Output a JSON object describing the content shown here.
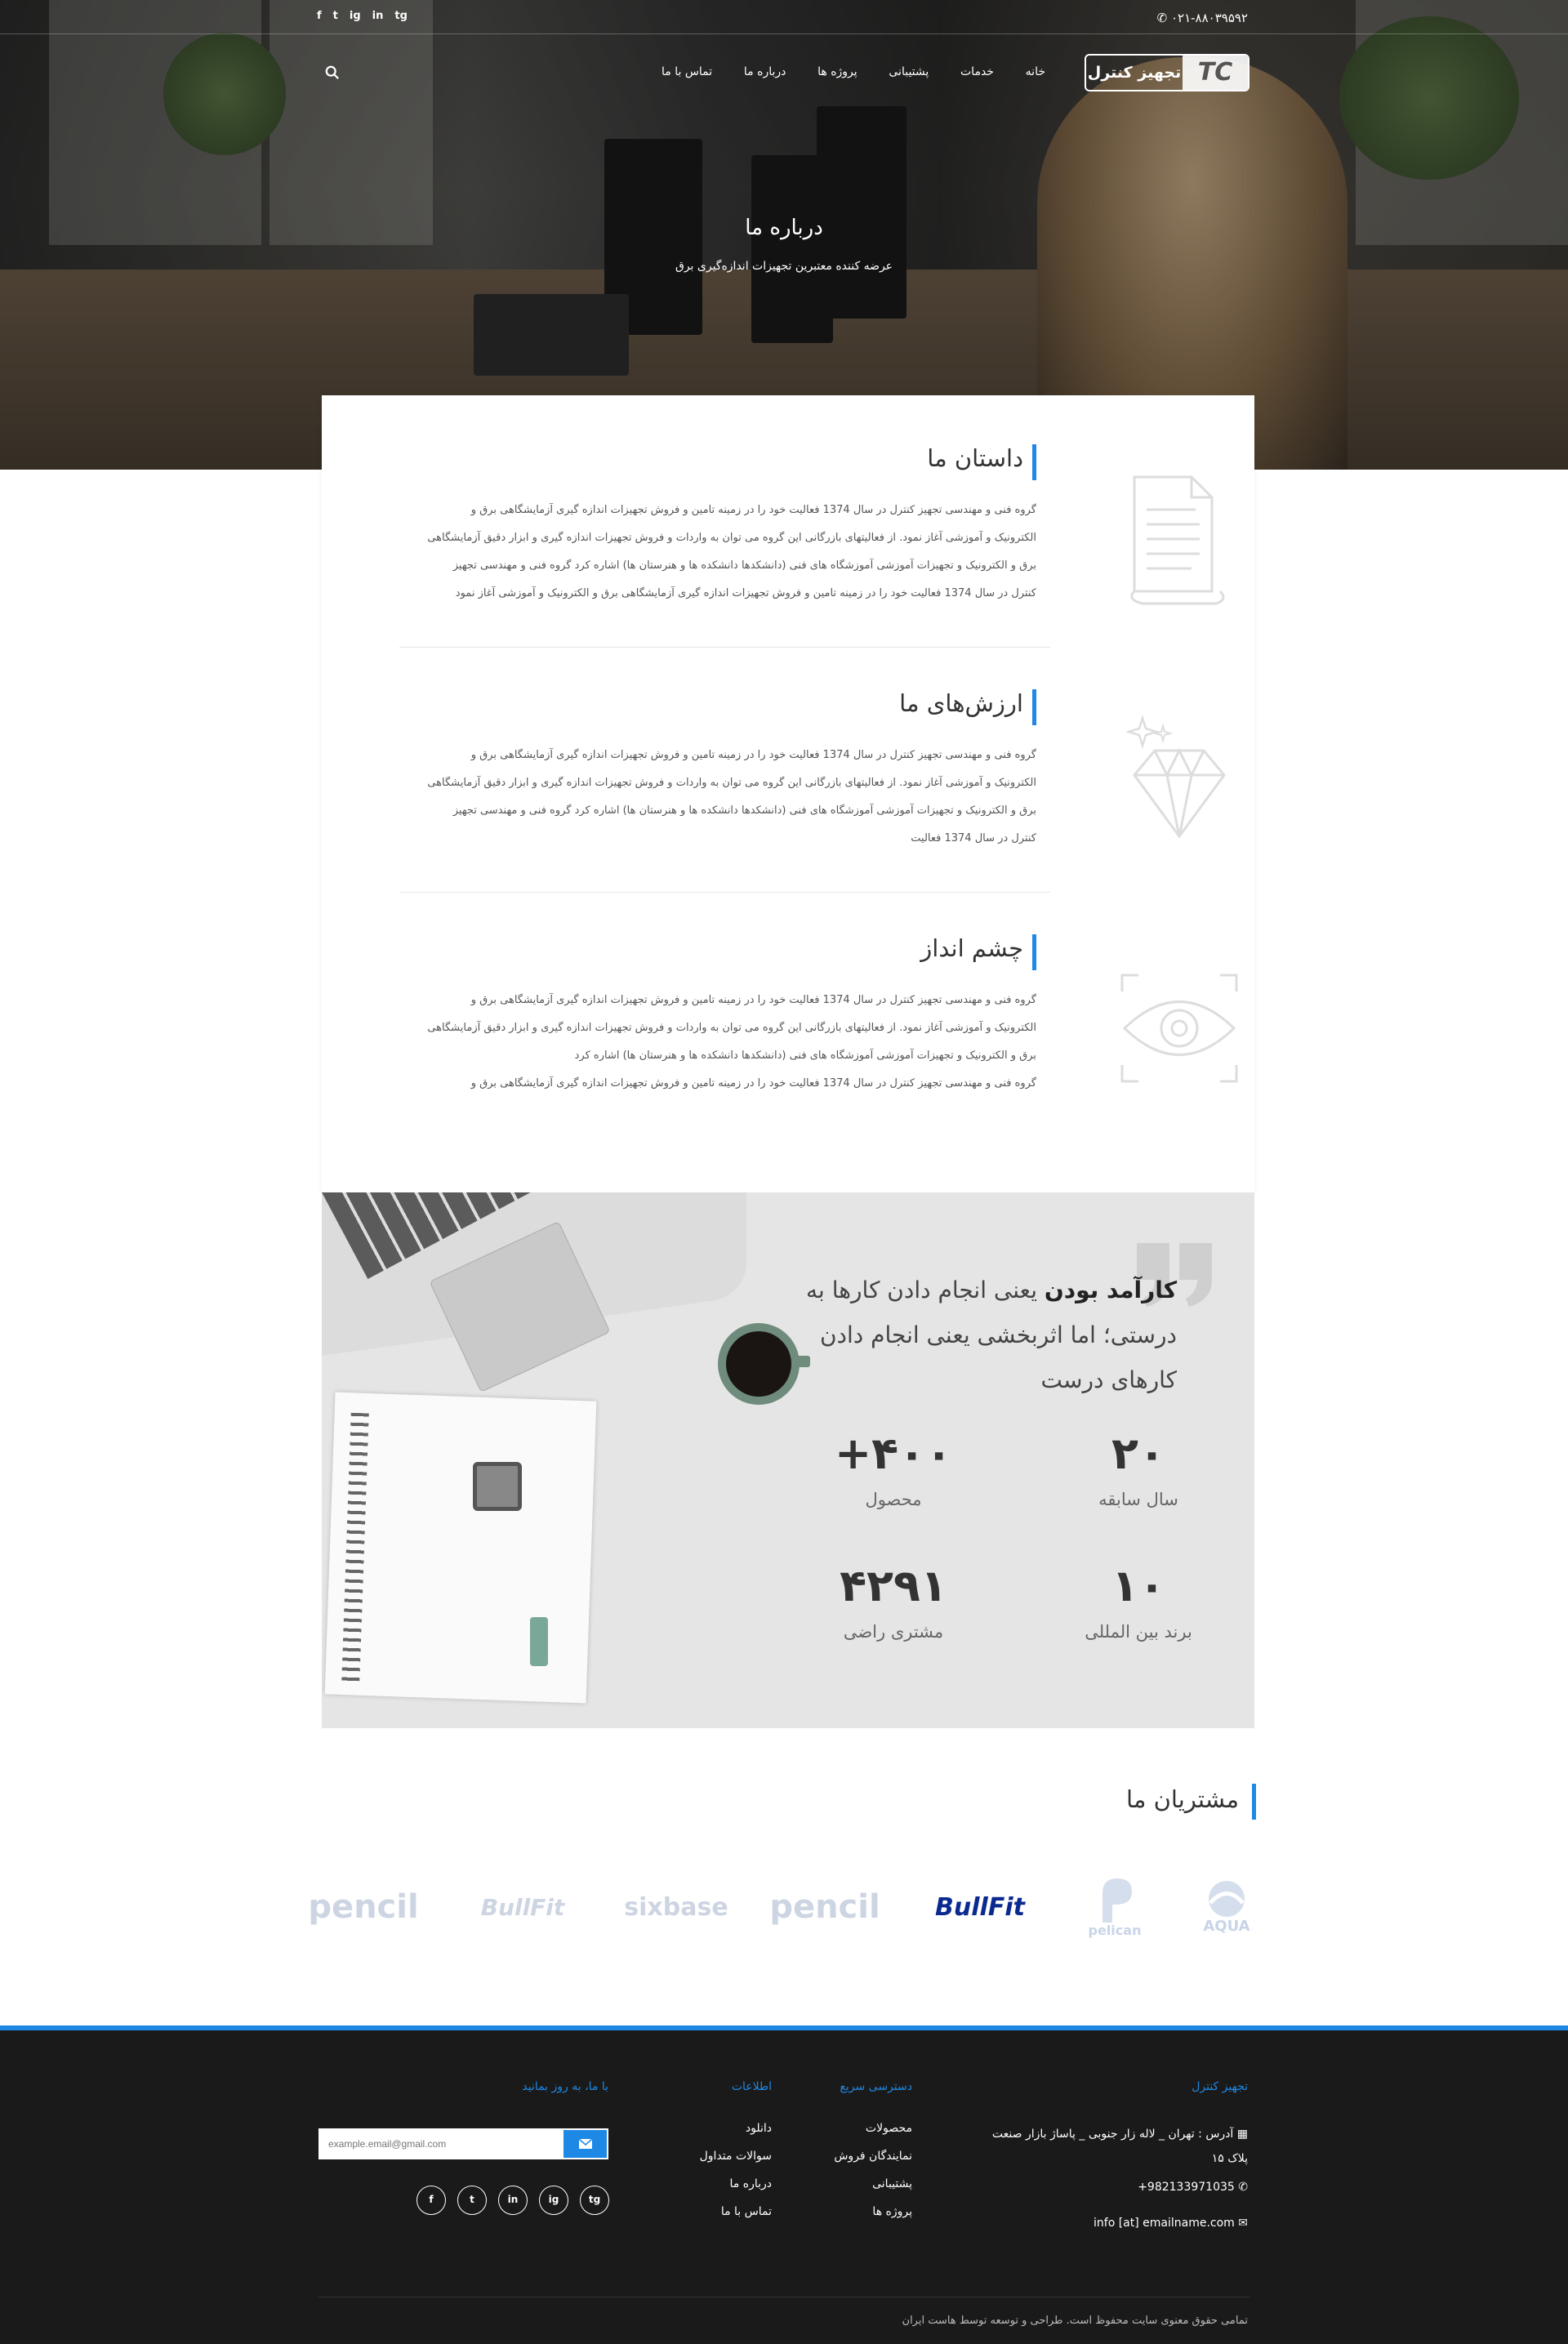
{
  "topbar": {
    "phone": "۰۲۱-۸۸۰۳۹۵۹۲",
    "social": [
      "f",
      "t",
      "ig",
      "in",
      "tg"
    ]
  },
  "header": {
    "logo_mark": "TC",
    "logo_name": "تجهیز کنترل",
    "nav": [
      "خانه",
      "خدمات",
      "پشتیبانی",
      "پروژه ها",
      "درباره ما",
      "تماس با ما"
    ]
  },
  "hero": {
    "title": "درباره ما",
    "subtitle": "عرضه کننده معتبرین تجهیزات اندازه‌گیری برق"
  },
  "sections": [
    {
      "title": "داستان ما",
      "icon": "document-icon",
      "lines": [
        "گروه فنی و مهندسی تجهیز کنترل در سال 1374 فعالیت خود را در زمینه تامین و فروش تجهیزات اندازه گیری آزمایشگاهی برق و",
        "الکترونیک و آموزشی آغاز نمود. از فعالیتهای بازرگانی این گروه می توان به واردات و فروش تجهیزات اندازه گیری و ابزار دقیق آزمایشگاهی",
        "برق و الکترونیک و تجهیزات آموزشی آموزشگاه های فنی (دانشکدها دانشکده ها و هنرستان ها) اشاره کرد گروه فنی و مهندسی تجهیز",
        "کنترل در سال 1374 فعالیت  خود را در زمینه تامین و فروش تجهیزات اندازه گیری آزمایشگاهی برق و الکترونیک و آموزشی آغاز نمود"
      ]
    },
    {
      "title": "ارزش‌های ما",
      "icon": "diamond-icon",
      "lines": [
        "گروه فنی و مهندسی تجهیز کنترل در سال 1374 فعالیت خود را در زمینه تامین و فروش تجهیزات اندازه گیری آزمایشگاهی برق و",
        "الکترونیک و آموزشی آغاز نمود. از فعالیتهای بازرگانی این گروه می توان به واردات و فروش تجهیزات اندازه گیری و ابزار دقیق آزمایشگاهی",
        "برق و الکترونیک و تجهیزات آموزشی آموزشگاه های فنی (دانشکدها دانشکده ها و هنرستان ها) اشاره کرد گروه فنی و مهندسی تجهیز",
        "کنترل در سال 1374 فعالیت"
      ]
    },
    {
      "title": "چشم انداز",
      "icon": "eye-icon",
      "lines": [
        "گروه فنی و مهندسی تجهیز کنترل در سال 1374 فعالیت خود را در زمینه تامین و فروش تجهیزات اندازه گیری آزمایشگاهی برق و",
        "الکترونیک و آموزشی آغاز نمود. از فعالیتهای بازرگانی این گروه می توان به واردات و فروش تجهیزات اندازه گیری و ابزار دقیق آزمایشگاهی",
        "برق و الکترونیک و تجهیزات آموزشی آموزشگاه های فنی (دانشکدها دانشکده ها و هنرستان ها) اشاره کرد",
        "گروه فنی و مهندسی تجهیز کنترل در سال 1374 فعالیت  خود را در زمینه تامین و فروش تجهیزات اندازه گیری آزمایشگاهی برق و"
      ]
    }
  ],
  "quote": {
    "bold": "کارآمد بودن",
    "rest": " یعنی انجام دادن کارها به درستی؛ اما اثربخشی یعنی انجام دادن کارهای درست"
  },
  "stats": [
    {
      "num": "۲۰",
      "label": "سال سابقه"
    },
    {
      "num": "+۴۰۰",
      "label": "محصول"
    },
    {
      "num": "۱۰",
      "label": "برند بین المللی"
    },
    {
      "num": "۴۲۹۱",
      "label": "مشتری راضی"
    }
  ],
  "clients": {
    "title": "مشتریان ما",
    "logos": [
      "AQUA",
      "pelican",
      "BullFit",
      "pencil",
      "sixbase",
      "BullFit",
      "pencil"
    ]
  },
  "footer": {
    "col1": {
      "title": "تجهیز کنترل",
      "address": "آدرس : تهران _ لاله زار جنوبی _ پاساژ بازار صنعت",
      "address2": "پلاک ۱۵",
      "phone": "+982133971035",
      "email": "info [at] emailname.com"
    },
    "col2": {
      "title": "دسترسی سریع",
      "links": [
        "محصولات",
        "نمایندگان فروش",
        "پشتیبانی",
        "پروژه ها"
      ]
    },
    "col3": {
      "title": "اطلاعات",
      "links": [
        "دانلود",
        "سوالات متداول",
        "درباره ما",
        "تماس با ما"
      ]
    },
    "col4": {
      "title": "با ما، به روز بمانید",
      "placeholder": "example.email@gmail.com"
    },
    "social": [
      "tg",
      "ig",
      "in",
      "t",
      "f"
    ],
    "copyright": "تمامی حقوق معنوی سایت محفوظ است. طراحی و توسعه توسط هاست ایران"
  },
  "colors": {
    "accent": "#1e88e5",
    "footer_bg": "#1a1a1a"
  }
}
